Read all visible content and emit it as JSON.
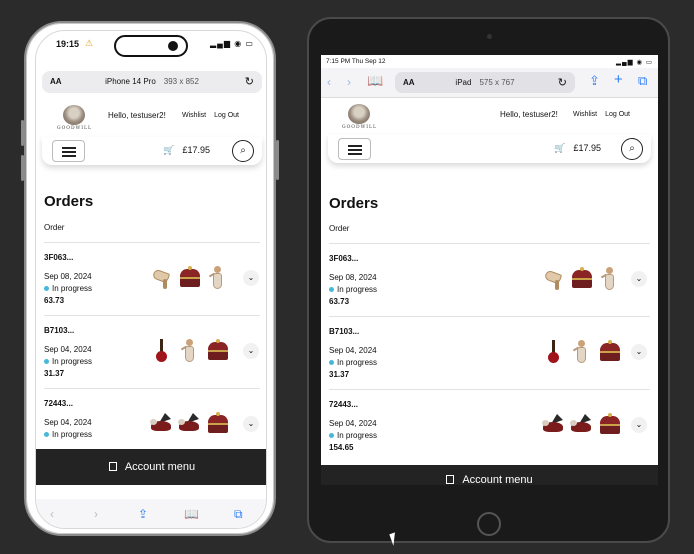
{
  "phone": {
    "status": {
      "time": "19:15",
      "warning": "⚠",
      "signal": "▂▄▆ ◉ ▭"
    },
    "url_bar": {
      "aa": "AA",
      "device": "iPhone 14 Pro",
      "size": "393 x 852",
      "reload": "↻"
    },
    "toolbar": {
      "back": "‹",
      "forward": "›",
      "share": "⇪",
      "bookmarks": "📖",
      "tabs": "⧉"
    }
  },
  "ipad": {
    "status": {
      "time": "7:15 PM  Thu Sep 12",
      "signal": "▂▄▆ ◉ ▭"
    },
    "url_bar": {
      "aa": "AA",
      "device": "iPad",
      "size": "575 x 767",
      "reload": "↻"
    },
    "nav": {
      "back": "‹",
      "forward": "›",
      "bookmarks": "📖",
      "share": "⇪",
      "new_tab": "+",
      "tabs": "⧉"
    }
  },
  "site": {
    "logo_text": "GOODWILL",
    "greeting": "Hello, testuser2!",
    "wishlist": "Wishlist",
    "logout": "Log Out",
    "cart_total": "£17.95",
    "cart_icon": "🛒",
    "search_icon": "⌕",
    "orders_title": "Orders",
    "order_column": "Order",
    "expand_icon": "⌄",
    "account_menu": "Account menu"
  },
  "phone_orders": [
    {
      "id": "3F063...",
      "date": "Sep 08, 2024",
      "status": "In progress",
      "total": "63.73"
    },
    {
      "id": "B7103...",
      "date": "Sep 04, 2024",
      "status": "In progress",
      "total": "31.37"
    },
    {
      "id": "72443...",
      "date": "Sep 04, 2024",
      "status": "In progress",
      "total": ""
    }
  ],
  "ipad_orders": [
    {
      "id": "3F063...",
      "date": "Sep 08, 2024",
      "status": "In progress",
      "total": "63.73"
    },
    {
      "id": "B7103...",
      "date": "Sep 04, 2024",
      "status": "In progress",
      "total": "31.37"
    },
    {
      "id": "72443...",
      "date": "Sep 04, 2024",
      "status": "In progress",
      "total": "154.65"
    }
  ],
  "colors": {
    "status_dot": "#46b8d8",
    "account_bar": "#232323",
    "accent": "#2f7cf6"
  }
}
